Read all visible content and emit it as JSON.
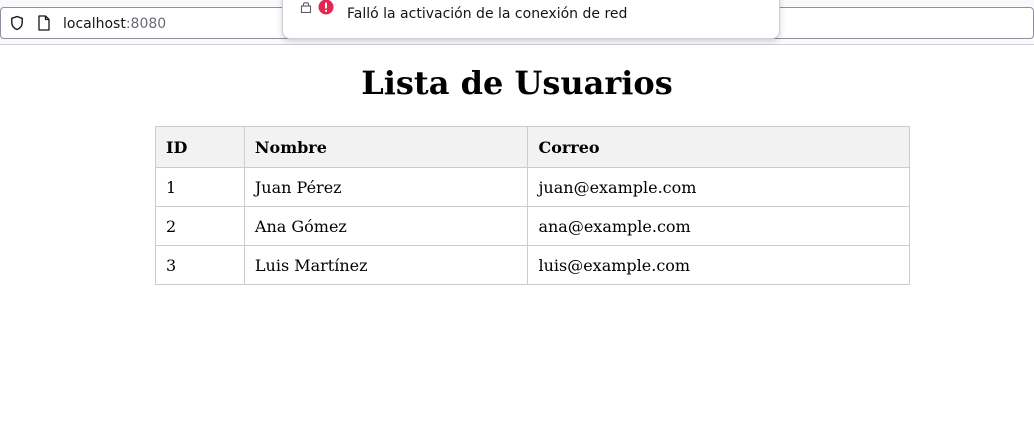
{
  "browser": {
    "url_host": "localhost",
    "url_port": ":8080",
    "icons": {
      "tracking": "shield-icon",
      "page": "page-icon"
    }
  },
  "notification": {
    "message": "Falló la activación de la conexión de red",
    "icons": {
      "permission": "lock-icon",
      "status": "error-icon"
    },
    "error_color": "#e22850"
  },
  "page": {
    "title": "Lista de Usuarios"
  },
  "table": {
    "headers": [
      "ID",
      "Nombre",
      "Correo"
    ],
    "rows": [
      [
        "1",
        "Juan Pérez",
        "juan@example.com"
      ],
      [
        "2",
        "Ana Gómez",
        "ana@example.com"
      ],
      [
        "3",
        "Luis Martínez",
        "luis@example.com"
      ]
    ],
    "header_bg": "#f2f2f2",
    "border_color": "#cccccc"
  }
}
